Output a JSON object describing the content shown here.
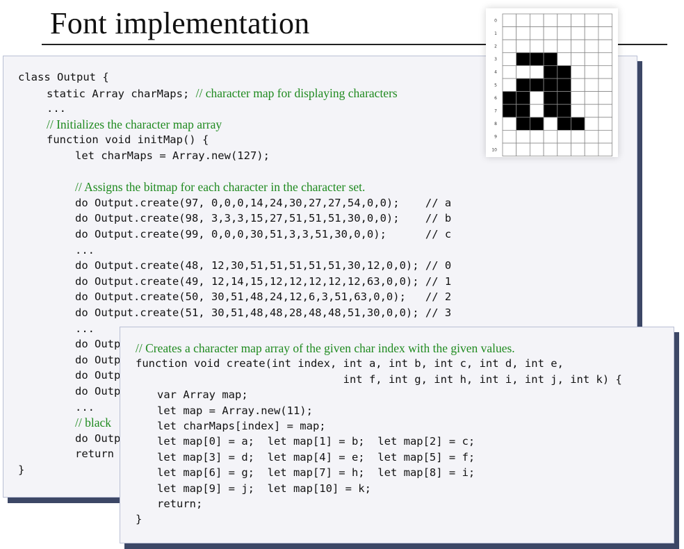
{
  "slide": {
    "title": "Font implementation"
  },
  "main_panel": {
    "lines": [
      {
        "code": "class Output {",
        "comment": "",
        "comment_only": false,
        "indent": 0
      },
      {
        "code": "static Array charMaps; ",
        "comment": "// character map for displaying characters",
        "comment_only": false,
        "indent": 1
      },
      {
        "code": "...",
        "comment": "",
        "comment_only": false,
        "indent": 1
      },
      {
        "code": "",
        "comment": "// Initializes the character map array",
        "comment_only": true,
        "indent": 1
      },
      {
        "code": "function void initMap() {",
        "comment": "",
        "comment_only": false,
        "indent": 1
      },
      {
        "code": "let charMaps = Array.new(127);",
        "comment": "",
        "comment_only": false,
        "indent": 2
      },
      {
        "code": "",
        "comment": "",
        "comment_only": false,
        "indent": 0
      },
      {
        "code": "",
        "comment": "// Assigns the bitmap for each character in the character set.",
        "comment_only": true,
        "indent": 2
      },
      {
        "code": "do Output.create(97, 0,0,0,14,24,30,27,27,54,0,0);    // a",
        "comment": "",
        "comment_only": false,
        "indent": 2
      },
      {
        "code": "do Output.create(98, 3,3,3,15,27,51,51,51,30,0,0);    // b",
        "comment": "",
        "comment_only": false,
        "indent": 2
      },
      {
        "code": "do Output.create(99, 0,0,0,30,51,3,3,51,30,0,0);      // c",
        "comment": "",
        "comment_only": false,
        "indent": 2
      },
      {
        "code": "...",
        "comment": "",
        "comment_only": false,
        "indent": 2
      },
      {
        "code": "do Output.create(48, 12,30,51,51,51,51,51,30,12,0,0); // 0",
        "comment": "",
        "comment_only": false,
        "indent": 2
      },
      {
        "code": "do Output.create(49, 12,14,15,12,12,12,12,12,63,0,0); // 1",
        "comment": "",
        "comment_only": false,
        "indent": 2
      },
      {
        "code": "do Output.create(50, 30,51,48,24,12,6,3,51,63,0,0);   // 2",
        "comment": "",
        "comment_only": false,
        "indent": 2
      },
      {
        "code": "do Output.create(51, 30,51,48,48,28,48,48,51,30,0,0); // 3",
        "comment": "",
        "comment_only": false,
        "indent": 2
      },
      {
        "code": "...",
        "comment": "",
        "comment_only": false,
        "indent": 2
      },
      {
        "code": "do Outp",
        "comment": "",
        "comment_only": false,
        "indent": 2
      },
      {
        "code": "do Outp",
        "comment": "",
        "comment_only": false,
        "indent": 2
      },
      {
        "code": "do Outp",
        "comment": "",
        "comment_only": false,
        "indent": 2
      },
      {
        "code": "do Outp",
        "comment": "",
        "comment_only": false,
        "indent": 2
      },
      {
        "code": "...",
        "comment": "",
        "comment_only": false,
        "indent": 2
      },
      {
        "code": "",
        "comment": "// black",
        "comment_only": true,
        "indent": 2
      },
      {
        "code": "do Outp",
        "comment": "",
        "comment_only": false,
        "indent": 2
      },
      {
        "code": "return",
        "comment": "",
        "comment_only": false,
        "indent": 2
      },
      {
        "code": "}",
        "comment": "",
        "comment_only": false,
        "indent": 0
      }
    ]
  },
  "create_panel": {
    "lines": [
      {
        "code": "",
        "comment": "// Creates a character map array of the given char index with the given values.",
        "comment_only": true,
        "indent": 0
      },
      {
        "code": "function void create(int index, int a, int b, int c, int d, int e,",
        "comment": "",
        "comment_only": false,
        "indent": 0
      },
      {
        "code": "                                int f, int g, int h, int i, int j, int k) {",
        "comment": "",
        "comment_only": false,
        "indent": 0
      },
      {
        "code": "var Array map;",
        "comment": "",
        "comment_only": false,
        "indent": 1
      },
      {
        "code": "let map = Array.new(11);",
        "comment": "",
        "comment_only": false,
        "indent": 1
      },
      {
        "code": "let charMaps[index] = map;",
        "comment": "",
        "comment_only": false,
        "indent": 1
      },
      {
        "code": "let map[0] = a;  let map[1] = b;  let map[2] = c;",
        "comment": "",
        "comment_only": false,
        "indent": 1
      },
      {
        "code": "let map[3] = d;  let map[4] = e;  let map[5] = f;",
        "comment": "",
        "comment_only": false,
        "indent": 1
      },
      {
        "code": "let map[6] = g;  let map[7] = h;  let map[8] = i;",
        "comment": "",
        "comment_only": false,
        "indent": 1
      },
      {
        "code": "let map[9] = j;  let map[10] = k;",
        "comment": "",
        "comment_only": false,
        "indent": 1
      },
      {
        "code": "return;",
        "comment": "",
        "comment_only": false,
        "indent": 1
      },
      {
        "code": "}",
        "comment": "",
        "comment_only": false,
        "indent": 0
      }
    ]
  },
  "glyph_grid": {
    "row_labels": [
      "0",
      "1",
      "2",
      "3",
      "4",
      "5",
      "6",
      "7",
      "8",
      "9",
      "10"
    ],
    "columns": 8,
    "rows": [
      0,
      0,
      0,
      14,
      24,
      30,
      27,
      27,
      54,
      0,
      0
    ],
    "ink_color": "#000000",
    "grid_color": "#888888"
  }
}
